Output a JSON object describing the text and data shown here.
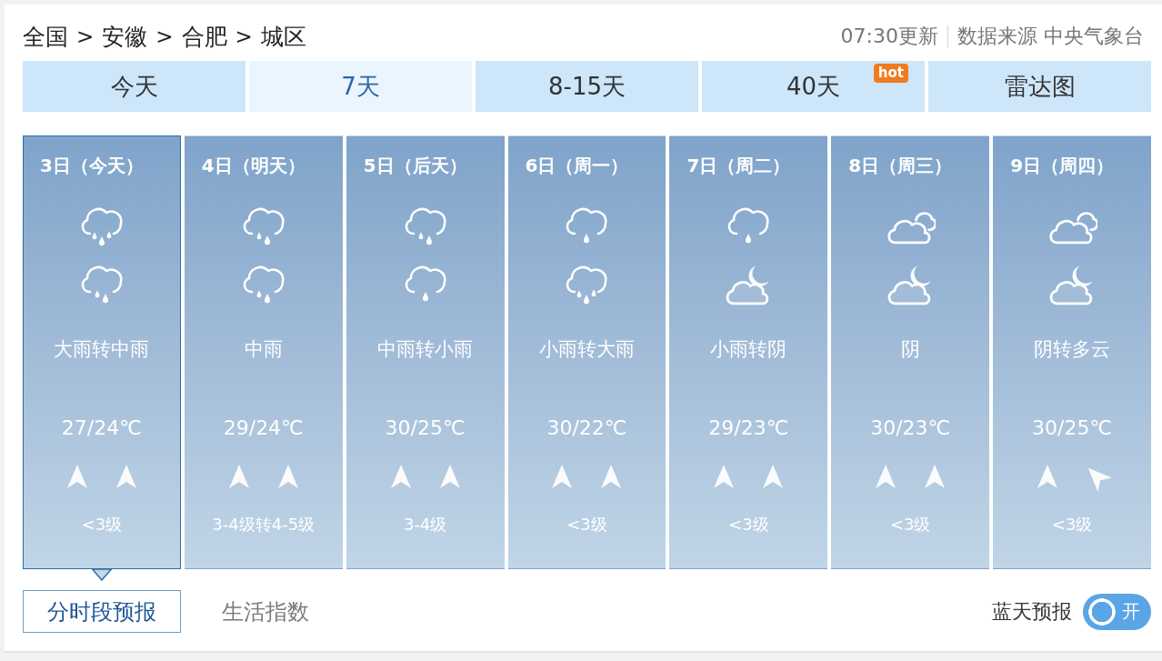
{
  "breadcrumb": {
    "items": [
      "全国",
      "安徽",
      "合肥",
      "城区"
    ],
    "separators": [
      ">",
      ">",
      ">"
    ]
  },
  "update_info": {
    "time_text": "07:30更新",
    "source_text": "数据来源 中央气象台"
  },
  "tabs": [
    {
      "label": "今天",
      "selected": false
    },
    {
      "label": "7天",
      "selected": true
    },
    {
      "label": "8-15天",
      "selected": false
    },
    {
      "label": "40天",
      "selected": false,
      "badge": "hot"
    },
    {
      "label": "雷达图",
      "selected": false
    }
  ],
  "days": [
    {
      "date": "3日（今天）",
      "selected": true,
      "weather_icons": [
        {
          "kind": "heavyrain"
        },
        {
          "kind": "rain"
        }
      ],
      "description": "大雨转中雨",
      "temperature": "27/24℃",
      "wind_arrows": [
        {
          "kind": "up"
        },
        {
          "kind": "up"
        }
      ],
      "wind_level": "<3级"
    },
    {
      "date": "4日（明天）",
      "selected": false,
      "weather_icons": [
        {
          "kind": "rain"
        },
        {
          "kind": "rain"
        }
      ],
      "description": "中雨",
      "temperature": "29/24℃",
      "wind_arrows": [
        {
          "kind": "up"
        },
        {
          "kind": "up"
        }
      ],
      "wind_level": "3-4级转4-5级"
    },
    {
      "date": "5日（后天）",
      "selected": false,
      "weather_icons": [
        {
          "kind": "rain"
        },
        {
          "kind": "lightrain"
        }
      ],
      "description": "中雨转小雨",
      "temperature": "30/25℃",
      "wind_arrows": [
        {
          "kind": "up"
        },
        {
          "kind": "up"
        }
      ],
      "wind_level": "3-4级"
    },
    {
      "date": "6日（周一）",
      "selected": false,
      "weather_icons": [
        {
          "kind": "lightrain"
        },
        {
          "kind": "heavyrain"
        }
      ],
      "description": "小雨转大雨",
      "temperature": "30/22℃",
      "wind_arrows": [
        {
          "kind": "up"
        },
        {
          "kind": "up"
        }
      ],
      "wind_level": "<3级"
    },
    {
      "date": "7日（周二）",
      "selected": false,
      "weather_icons": [
        {
          "kind": "lightrain"
        },
        {
          "kind": "nightcloud"
        }
      ],
      "description": "小雨转阴",
      "temperature": "29/23℃",
      "wind_arrows": [
        {
          "kind": "up"
        },
        {
          "kind": "up"
        }
      ],
      "wind_level": "<3级"
    },
    {
      "date": "8日（周三）",
      "selected": false,
      "weather_icons": [
        {
          "kind": "overcast"
        },
        {
          "kind": "nightcloud"
        }
      ],
      "description": "阴",
      "temperature": "30/23℃",
      "wind_arrows": [
        {
          "kind": "up"
        },
        {
          "kind": "up"
        }
      ],
      "wind_level": "<3级"
    },
    {
      "date": "9日（周四）",
      "selected": false,
      "weather_icons": [
        {
          "kind": "overcast"
        },
        {
          "kind": "nightcloud"
        }
      ],
      "description": "阴转多云",
      "temperature": "30/25℃",
      "wind_arrows": [
        {
          "kind": "up"
        },
        {
          "kind": "upleft"
        }
      ],
      "wind_level": "<3级"
    }
  ],
  "sub_tabs": [
    {
      "label": "分时段预报",
      "selected": true
    },
    {
      "label": "生活指数",
      "selected": false
    }
  ],
  "blue_sky_toggle": {
    "label": "蓝天预报",
    "on": true,
    "state_text": "开"
  }
}
